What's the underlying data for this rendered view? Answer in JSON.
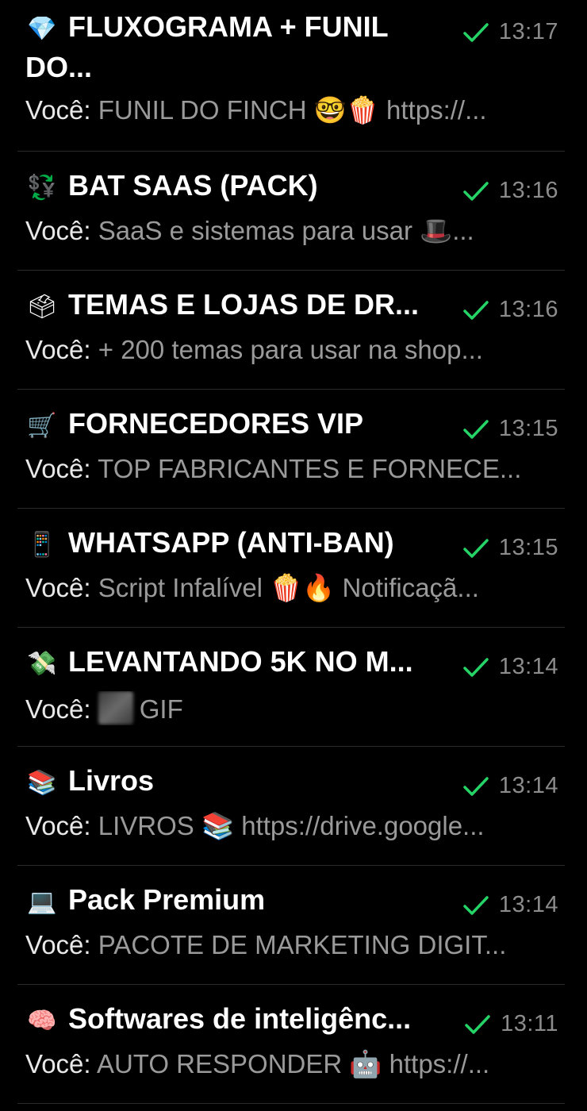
{
  "colors": {
    "background": "#000000",
    "title": "#ffffff",
    "preview_sender": "#e8e8e8",
    "preview_text": "#9a9a9a",
    "time": "#8c8c8c",
    "check": "#25d366",
    "divider": "#2a2a2a"
  },
  "chats": [
    {
      "icon": "gem-emoji",
      "emoji": "💎",
      "title": "FLUXOGRAMA + FUNIL DO...",
      "time": "13:17",
      "sender": "Você:",
      "message": "FUNIL DO FINCH 🤓🍿  https://..."
    },
    {
      "icon": "currency-exchange-emoji",
      "emoji": "💱",
      "title": "BAT SAAS (PACK)",
      "time": "13:16",
      "sender": "Você:",
      "message": "SaaS e sistemas para usar 🎩..."
    },
    {
      "icon": "ballot-box-emoji",
      "emoji": "🗳",
      "title": "TEMAS E LOJAS DE DR...",
      "time": "13:16",
      "sender": "Você:",
      "message": "+ 200 temas para usar na shop..."
    },
    {
      "icon": "shopping-cart-emoji",
      "emoji": "🛒",
      "title": "FORNECEDORES VIP",
      "time": "13:15",
      "sender": "Você:",
      "message": "TOP FABRICANTES E FORNECE..."
    },
    {
      "icon": "mobile-phone-emoji",
      "emoji": "📱",
      "title": "WHATSAPP (ANTI-BAN)",
      "time": "13:15",
      "sender": "Você:",
      "message": "Script Infalível 🍿🔥  Notificaçã..."
    },
    {
      "icon": "money-with-wings-emoji",
      "emoji": "💸",
      "title": "LEVANTANDO 5K NO M...",
      "time": "13:14",
      "sender": "Você:",
      "message": "GIF",
      "has_thumb": true
    },
    {
      "icon": "books-emoji",
      "emoji": "📚",
      "title": "Livros",
      "time": "13:14",
      "sender": "Você:",
      "message": "LIVROS 📚  https://drive.google..."
    },
    {
      "icon": "laptop-emoji",
      "emoji": "💻",
      "title": "Pack Premium",
      "time": "13:14",
      "sender": "Você:",
      "message": "PACOTE DE MARKETING DIGIT..."
    },
    {
      "icon": "brain-emoji",
      "emoji": "🧠",
      "title": "Softwares de inteligênc...",
      "time": "13:11",
      "sender": "Você:",
      "message": "AUTO RESPONDER 🤖  https://..."
    }
  ]
}
